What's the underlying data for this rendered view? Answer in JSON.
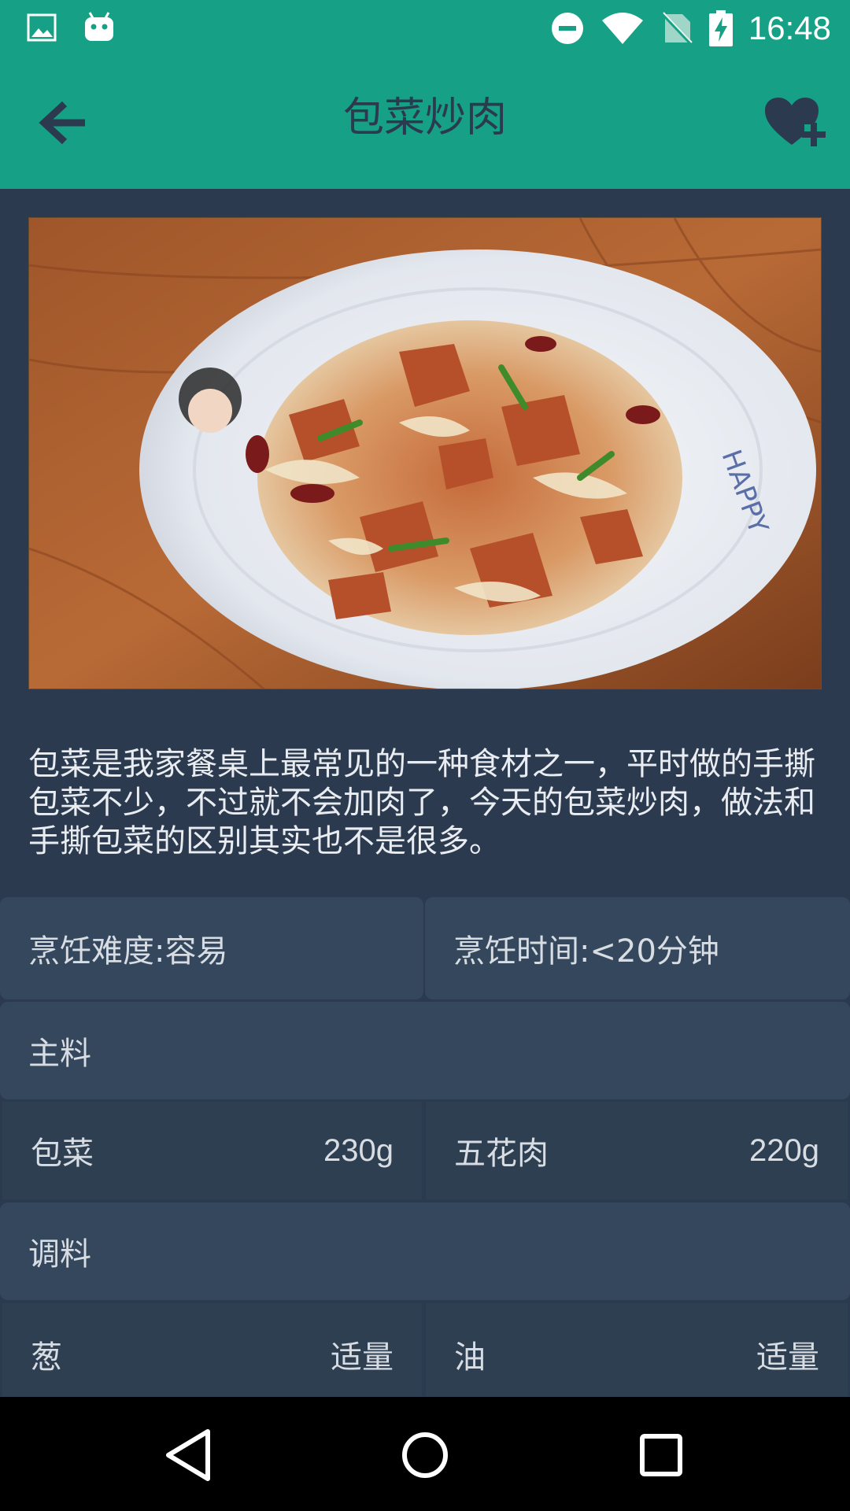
{
  "status_bar": {
    "time": "16:48",
    "left_icons": [
      "image-icon",
      "android-icon"
    ],
    "right_icons": [
      "do-not-disturb-icon",
      "wifi-icon",
      "no-sim-icon",
      "battery-charging-icon"
    ]
  },
  "app_bar": {
    "title": "包菜炒肉",
    "back_icon": "arrow-back-icon",
    "favorite_icon": "heart-plus-icon"
  },
  "recipe": {
    "image_alt": "包菜炒肉",
    "description": "包菜是我家餐桌上最常见的一种食材之一，平时做的手撕包菜不少，不过就不会加肉了，今天的包菜炒肉，做法和手撕包菜的区别其实也不是很多。",
    "difficulty": "烹饪难度:容易",
    "time": "烹饪时间:<20分钟",
    "main_section": "主料",
    "main_ingredients": [
      {
        "name": "包菜",
        "amount": "230g"
      },
      {
        "name": "五花肉",
        "amount": "220g"
      }
    ],
    "seasoning_section": "调料",
    "seasonings": [
      {
        "name": "葱",
        "amount": "适量"
      },
      {
        "name": "油",
        "amount": "适量"
      }
    ]
  },
  "colors": {
    "primary": "#16a085",
    "background": "#2c3a4f",
    "cell": "#34475d"
  },
  "nav_bar": {
    "icons": [
      "back-triangle-icon",
      "home-circle-icon",
      "recents-square-icon"
    ]
  }
}
